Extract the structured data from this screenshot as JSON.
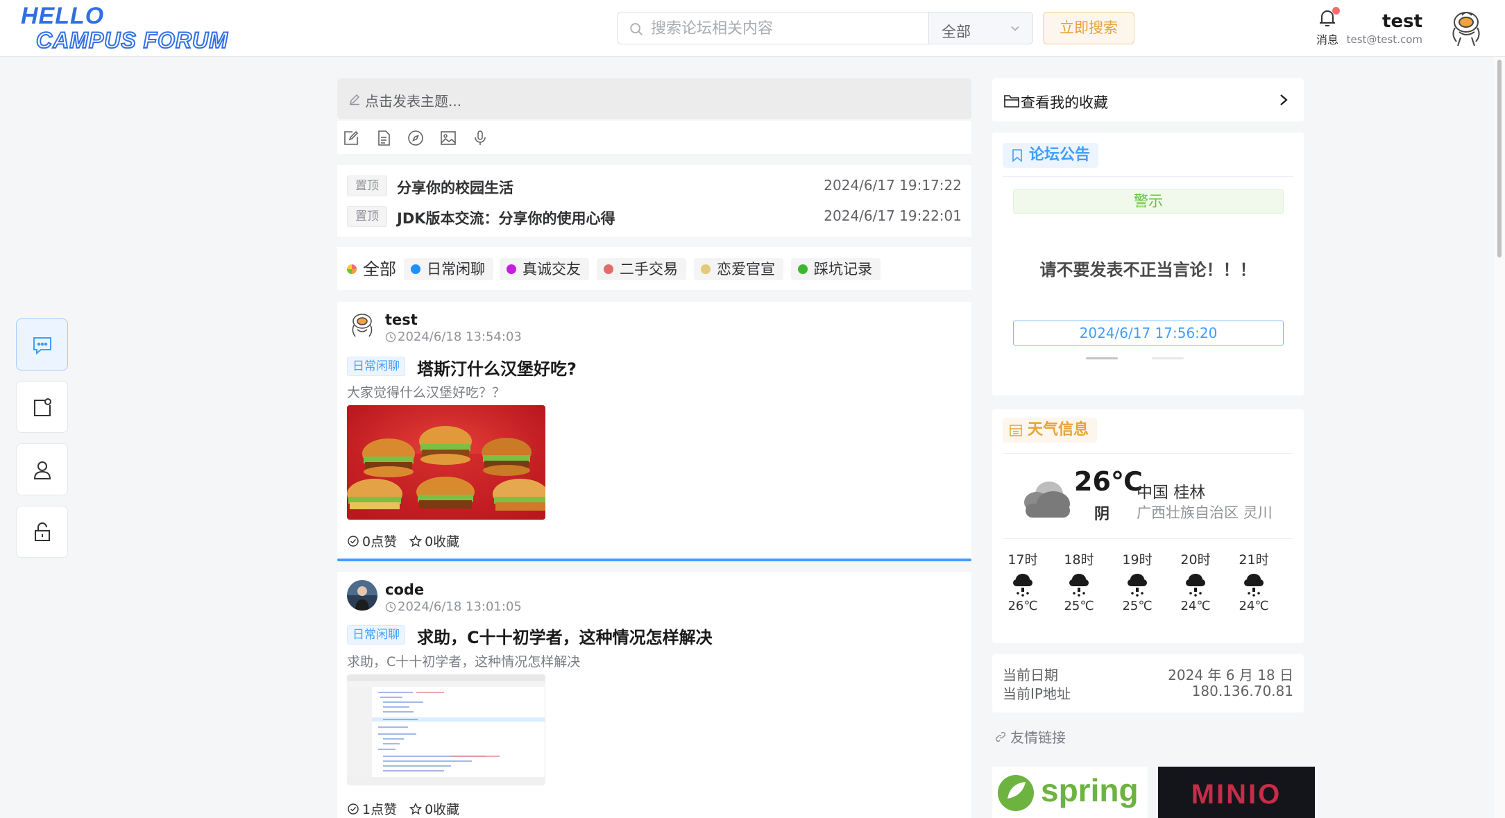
{
  "app": {
    "logo_line1": "HELLO",
    "logo_line2": "CAMPUS FORUM",
    "accent": "#409eff"
  },
  "search": {
    "placeholder": "搜索论坛相关内容",
    "scope": "全部",
    "button": "立即搜索"
  },
  "header": {
    "messages_label": "消息",
    "user_name": "test",
    "user_email": "test@test.com"
  },
  "nav": {
    "items": [
      {
        "icon": "chat-icon",
        "active": true
      },
      {
        "icon": "edit-box-icon",
        "active": false
      },
      {
        "icon": "user-icon",
        "active": false
      },
      {
        "icon": "unlock-icon",
        "active": false
      }
    ]
  },
  "composer": {
    "placeholder": "点击发表主题...",
    "tools": [
      "edit-icon",
      "document-icon",
      "compass-icon",
      "image-icon",
      "microphone-icon"
    ]
  },
  "pinned": [
    {
      "tag": "置顶",
      "title": "分享你的校园生活",
      "time": "2024/6/17 19:17:22"
    },
    {
      "tag": "置顶",
      "title": "JDK版本交流：分享你的使用心得",
      "time": "2024/6/17 19:22:01"
    }
  ],
  "categories": [
    {
      "label": "全部",
      "color": "multi"
    },
    {
      "label": "日常闲聊",
      "color": "#1e90ff"
    },
    {
      "label": "真诚交友",
      "color": "#c71de0"
    },
    {
      "label": "二手交易",
      "color": "#e36b6b"
    },
    {
      "label": "恋爱官宣",
      "color": "#e3c97a"
    },
    {
      "label": "踩坑记录",
      "color": "#3cb82f"
    }
  ],
  "posts": [
    {
      "author": "test",
      "time": "2024/6/18 13:54:03",
      "tag": "日常闲聊",
      "title": "塔斯汀什么汉堡好吃?",
      "summary": "大家觉得什么汉堡好吃？？",
      "likes": "0点赞",
      "favorites": "0收藏"
    },
    {
      "author": "code",
      "time": "2024/6/18 13:01:05",
      "tag": "日常闲聊",
      "title": "求助，C十十初学者，这种情况怎样解决",
      "summary": "求助，C十十初学者，这种情况怎样解决",
      "likes": "1点赞",
      "favorites": "0收藏"
    }
  ],
  "favorites_link": "查看我的收藏",
  "notice": {
    "heading": "论坛公告",
    "type": "警示",
    "message": "请不要发表不正当言论！！！",
    "date": "2024/6/17 17:56:20"
  },
  "weather": {
    "heading": "天气信息",
    "temp": "26℃",
    "city": "中国 桂林",
    "condition": "阴",
    "region": "广西壮族自治区 灵川",
    "hourly": [
      {
        "hour": "17时",
        "temp": "26℃"
      },
      {
        "hour": "18时",
        "temp": "25℃"
      },
      {
        "hour": "19时",
        "temp": "25℃"
      },
      {
        "hour": "20时",
        "temp": "24℃"
      },
      {
        "hour": "21时",
        "temp": "24℃"
      }
    ]
  },
  "info": {
    "date_label": "当前日期",
    "date_value": "2024 年 6 月 18 日",
    "ip_label": "当前IP地址",
    "ip_value": "180.136.70.81"
  },
  "links": {
    "heading": "友情链接",
    "items": [
      "spring",
      "MINIO"
    ]
  }
}
